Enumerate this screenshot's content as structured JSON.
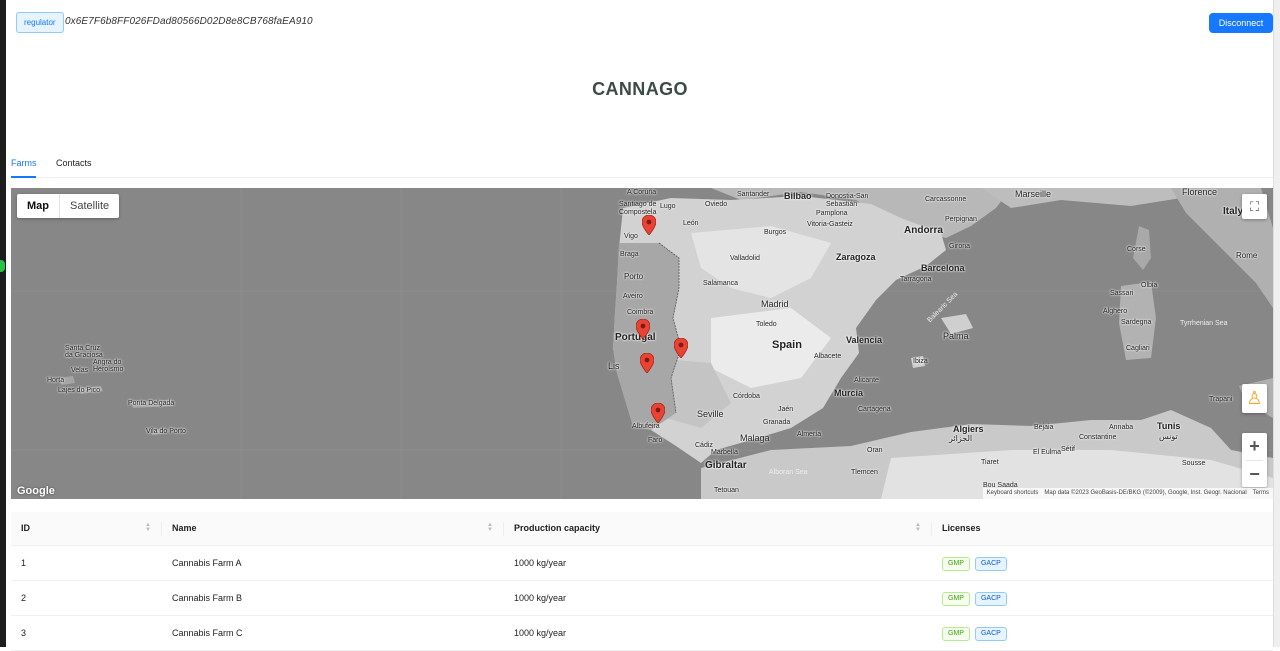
{
  "header": {
    "role": "regulator",
    "address": "0x6E7F6b8FF026FDad80566D02D8e8CB768faEA910",
    "disconnect_label": "Disconnect"
  },
  "logo": "CANNAGO",
  "tabs": [
    {
      "label": "Farms"
    },
    {
      "label": "Contacts"
    }
  ],
  "map": {
    "type_options": [
      "Map",
      "Satellite"
    ],
    "google_label": "Google",
    "attribution": [
      "Keyboard shortcuts",
      "Map data ©2023 GeoBasis-DE/BKG (©2009), Google, Inst. Geogr. Nacional",
      "Terms"
    ],
    "labels": {
      "portugal": "Portugal",
      "spain": "Spain",
      "italy": "Italy",
      "madrid": "Madrid",
      "andorra": "Andorra",
      "gibraltar": "Gibraltar",
      "porto": "Porto",
      "lisbon": "Lis",
      "seville": "Seville",
      "malaga": "Malaga",
      "valencia": "Valencia",
      "barcelona": "Barcelona",
      "zaragoza": "Zaragoza",
      "bilbao": "Bilbao",
      "marseille": "Marseille",
      "florence": "Florence",
      "rome": "Rome",
      "palma": "Palma",
      "algiers": "Algiers",
      "tunis": "Tunis",
      "murcia": "Murcia",
      "alicante": "Alicante",
      "granada": "Granada",
      "cordoba": "Córdoba",
      "valladolid": "Valladolid",
      "salamanca": "Salamanca",
      "coimbra": "Coimbra",
      "toledo": "Toledo",
      "albacete": "Albacete",
      "faro": "Faro",
      "albufeira": "Albufeira",
      "tetouan": "Tetouan",
      "horta": "Horta",
      "ponta_delgada": "Ponta Delgada",
      "santa_cruz": "Santa Cruz\nda Graciosa",
      "angra": "Angra do\nHeroísmo",
      "velas": "Velas",
      "lajes": "Lajes do Pico",
      "vila_do_porto": "Vila do Porto",
      "a_coruna": "A Coruña",
      "santiago": "Santiago de\nCompostela",
      "lugo": "Lugo",
      "vigo": "Vigo",
      "oviedo": "Oviedo",
      "santander": "Santander",
      "donostia": "Donostia-San\nSebastián",
      "pamplona": "Pamplona",
      "vitoria": "Vitoria-Gasteiz",
      "burgos": "Burgos",
      "leon": "León",
      "carcassonne": "Carcassonne",
      "perpignan": "Perpignan",
      "girona": "Girona",
      "tarragona": "Tarragona",
      "ibiza": "Ibiza",
      "cagliari": "Cagliari",
      "sardegna": "Sardegna",
      "sassari": "Sassari",
      "olbia": "Olbia",
      "alghero": "Alghero",
      "corse": "Corse",
      "tyrrhenian": "Tyrrhenian Sea",
      "balearic": "Balearic Sea",
      "alboran": "Alboran Sea",
      "trapani": "Trapani",
      "sousse": "Sousse",
      "el_eulma": "El Eulma",
      "bou_saada": "Bou Saada",
      "oran": "Oran",
      "bejaia": "Bejaia",
      "annaba": "Annaba",
      "aveiro": "Aveiro",
      "braga": "Braga",
      "cadiz": "Cádiz",
      "marbella": "Marbella",
      "almeria": "Almería",
      "jaen": "Jaén",
      "cartagena": "Cartagena",
      "tlemcen": "Tlemcen",
      "setif": "Sétif",
      "constantine": "Constantine",
      "algiers_ar": "الجزائر",
      "tunis_ar": "تونس",
      "tiaret": "Tiaret"
    },
    "markers": [
      {
        "lon": -8.4,
        "lat": 41.55
      },
      {
        "lon": -8.55,
        "lat": 39.55
      },
      {
        "lon": -7.65,
        "lat": 39.2
      },
      {
        "lon": -8.45,
        "lat": 38.9
      },
      {
        "lon": -8.2,
        "lat": 37.95
      }
    ]
  },
  "table": {
    "columns": [
      "ID",
      "Name",
      "Production capacity",
      "Licenses"
    ],
    "rows": [
      {
        "id": "1",
        "name": "Cannabis Farm A",
        "capacity": "1000 kg/year",
        "licenses": [
          "GMP",
          "GACP"
        ]
      },
      {
        "id": "2",
        "name": "Cannabis Farm B",
        "capacity": "1000 kg/year",
        "licenses": [
          "GMP",
          "GACP"
        ]
      },
      {
        "id": "3",
        "name": "Cannabis Farm C",
        "capacity": "1000 kg/year",
        "licenses": [
          "GMP",
          "GACP"
        ]
      }
    ]
  }
}
